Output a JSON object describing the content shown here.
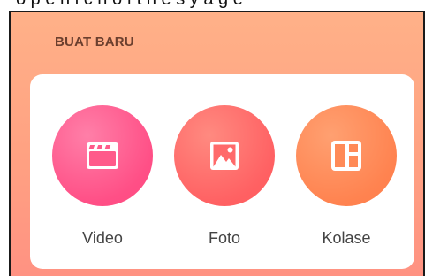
{
  "section": {
    "title": "BUAT BARU"
  },
  "top_strip": {
    "text": "o p e n   i c n   o f   t h e   s y   a g e"
  },
  "options": [
    {
      "id": "video",
      "label": "Video",
      "icon": "clapperboard-icon",
      "color": "#ff4f86"
    },
    {
      "id": "foto",
      "label": "Foto",
      "icon": "image-icon",
      "color": "#ff6163"
    },
    {
      "id": "kolase",
      "label": "Kolase",
      "icon": "collage-layout-icon",
      "color": "#ff8350"
    }
  ]
}
